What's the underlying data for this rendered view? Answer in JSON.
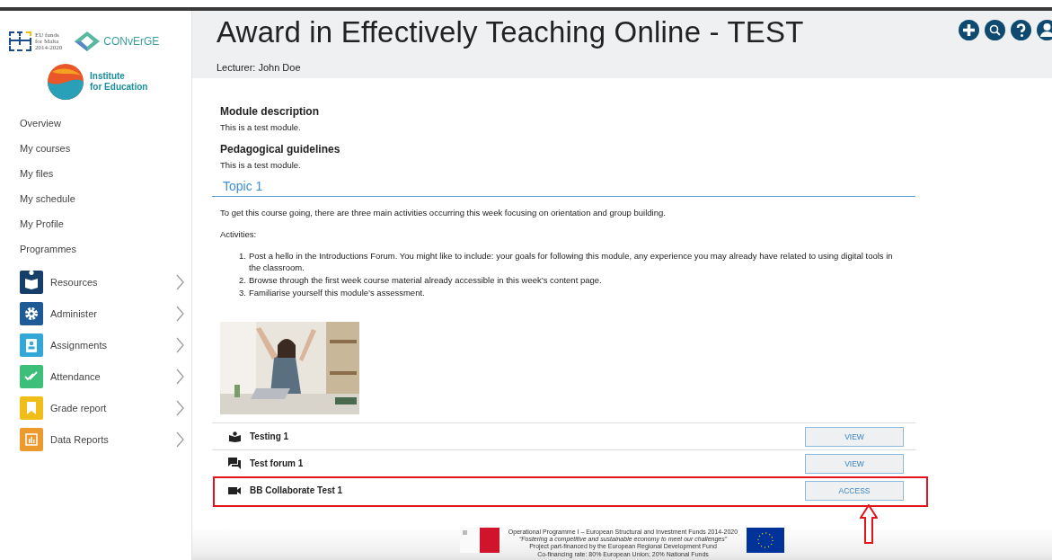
{
  "logos": {
    "eu_funds": [
      "EU funds",
      "for Malta",
      "2014-2020"
    ],
    "converge": "CONvErGE",
    "institute": [
      "Institute",
      "for Education"
    ]
  },
  "sidebar": {
    "links": [
      "Overview",
      "My courses",
      "My files",
      "My schedule",
      "My Profile",
      "Programmes"
    ],
    "items": [
      {
        "label": "Resources",
        "color": "#153e6b"
      },
      {
        "label": "Administer",
        "color": "#1e5a96"
      },
      {
        "label": "Assignments",
        "color": "#33a8d8"
      },
      {
        "label": "Attendance",
        "color": "#3dbf7a"
      },
      {
        "label": "Grade report",
        "color": "#f0bd19"
      },
      {
        "label": "Data Reports",
        "color": "#ec9a2e"
      }
    ]
  },
  "header": {
    "title": "Award in Effectively Teaching Online - TEST",
    "lecturer": "Lecturer: John Doe"
  },
  "module": {
    "sections": [
      {
        "heading": "Module description",
        "text": "This is a test module."
      },
      {
        "heading": "Pedagogical guidelines",
        "text": "This is a test module."
      }
    ],
    "topic": "Topic 1",
    "intro": "To get this course going, there are three main activities occurring this week focusing on orientation and group building.",
    "activities_label": "Activities:",
    "steps": [
      {
        "marker": "1.",
        "text": "Post a hello in the Introductions Forum. You might like to include: your goals for following this module, any experience you may already have related to using digital tools in the classroom."
      },
      {
        "marker": "2.",
        "text": "Browse through the first week course material already accessible in this week’s content page."
      },
      {
        "marker": "3.",
        "text": "Familiarise yourself this module’s assessment."
      }
    ],
    "activities": [
      {
        "name": "Testing 1",
        "kind": "book",
        "action": "VIEW",
        "highlighted": false
      },
      {
        "name": "Test forum 1",
        "kind": "forum",
        "action": "VIEW",
        "highlighted": false
      },
      {
        "name": "BB Collaborate Test 1",
        "kind": "video",
        "action": "ACCESS",
        "highlighted": true
      }
    ]
  },
  "footer": {
    "lines": [
      "Operational Programme I – European Structural and Investment Funds 2014-2020",
      "“Fostering a competitive and sustainable economy to meet our challenges”",
      "Project part-financed by the European Regional Development Fund",
      "Co-financing rate: 80% European Union; 20% National Funds"
    ]
  }
}
